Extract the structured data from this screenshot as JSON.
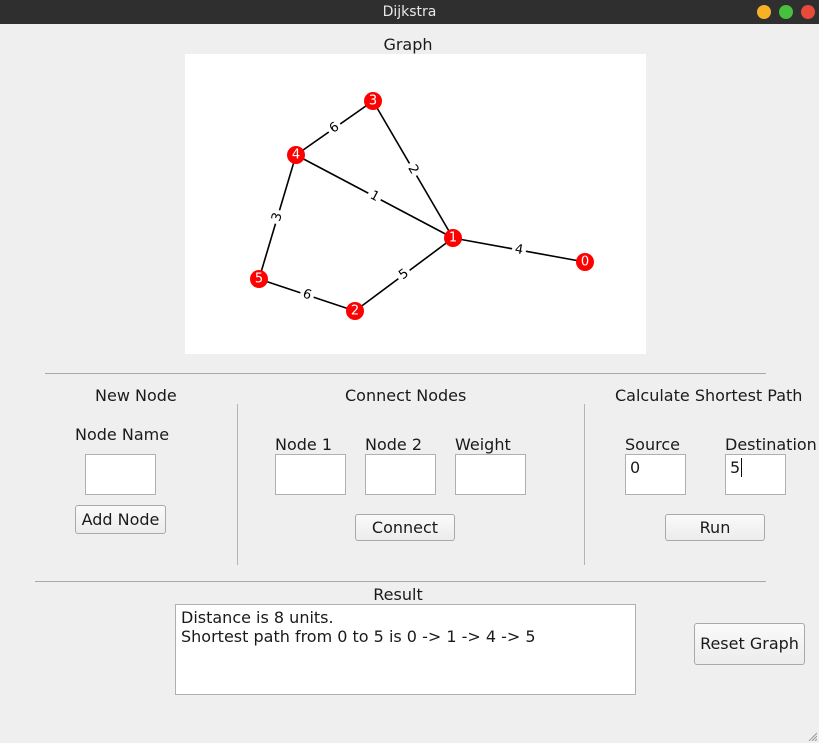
{
  "window": {
    "title": "Dijkstra",
    "buttons": {
      "minimize_color": "#f6b227",
      "maximize_color": "#46c03e",
      "close_color": "#ea4a3c"
    }
  },
  "graph": {
    "title": "Graph",
    "node_color": "#ff0000",
    "nodes": [
      {
        "id": "0",
        "label": "0"
      },
      {
        "id": "1",
        "label": "1"
      },
      {
        "id": "2",
        "label": "2"
      },
      {
        "id": "3",
        "label": "3"
      },
      {
        "id": "4",
        "label": "4"
      },
      {
        "id": "5",
        "label": "5"
      }
    ],
    "edges": [
      {
        "from": "3",
        "to": "4",
        "weight": "6"
      },
      {
        "from": "3",
        "to": "1",
        "weight": "2"
      },
      {
        "from": "4",
        "to": "1",
        "weight": "1"
      },
      {
        "from": "4",
        "to": "5",
        "weight": "3"
      },
      {
        "from": "1",
        "to": "0",
        "weight": "4"
      },
      {
        "from": "1",
        "to": "2",
        "weight": "5"
      },
      {
        "from": "5",
        "to": "2",
        "weight": "6"
      }
    ]
  },
  "new_node": {
    "title": "New Node",
    "name_label": "Node Name",
    "name_value": "",
    "add_button": "Add Node"
  },
  "connect": {
    "title": "Connect Nodes",
    "node1_label": "Node 1",
    "node2_label": "Node 2",
    "weight_label": "Weight",
    "node1_value": "",
    "node2_value": "",
    "weight_value": "",
    "connect_button": "Connect"
  },
  "shortest": {
    "title": "Calculate Shortest Path",
    "source_label": "Source",
    "destination_label": "Destination",
    "source_value": "0",
    "destination_value": "5",
    "run_button": "Run"
  },
  "result": {
    "title": "Result",
    "lines": [
      "Distance is 8 units.",
      "Shortest path from 0 to 5 is 0 -> 1 -> 4 -> 5"
    ]
  },
  "reset_button": "Reset Graph"
}
